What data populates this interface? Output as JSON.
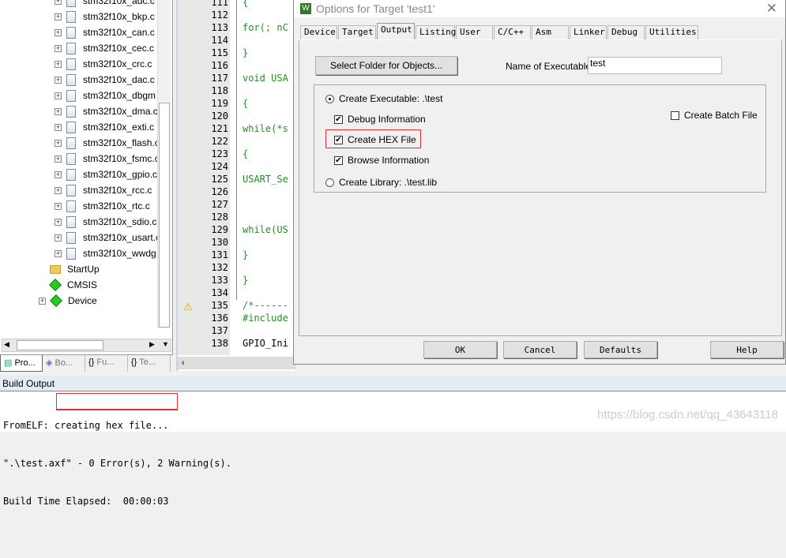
{
  "project": {
    "files": [
      "stm32f10x_adc.c",
      "stm32f10x_bkp.c",
      "stm32f10x_can.c",
      "stm32f10x_cec.c",
      "stm32f10x_crc.c",
      "stm32f10x_dac.c",
      "stm32f10x_dbgm",
      "stm32f10x_dma.c",
      "stm32f10x_exti.c",
      "stm32f10x_flash.c",
      "stm32f10x_fsmc.c",
      "stm32f10x_gpio.c",
      "stm32f10x_rcc.c",
      "stm32f10x_rtc.c",
      "stm32f10x_sdio.c",
      "stm32f10x_usart.c",
      "stm32f10x_wwdg."
    ],
    "groups": [
      {
        "label": "StartUp",
        "icon": "folder-icon"
      },
      {
        "label": "CMSIS",
        "icon": "component-icon"
      },
      {
        "label": "Device",
        "icon": "component-warning-icon"
      }
    ],
    "tabs": [
      "Pro...",
      "Bo...",
      "Fu...",
      "Te..."
    ]
  },
  "editor": {
    "lines": [
      [
        "111",
        "{"
      ],
      [
        "112",
        ""
      ],
      [
        "113",
        "for(; nC"
      ],
      [
        "114",
        ""
      ],
      [
        "115",
        "}"
      ],
      [
        "116",
        ""
      ],
      [
        "117",
        "void USA"
      ],
      [
        "118",
        ""
      ],
      [
        "119",
        "{"
      ],
      [
        "120",
        ""
      ],
      [
        "121",
        "while(*s"
      ],
      [
        "122",
        ""
      ],
      [
        "123",
        "{"
      ],
      [
        "124",
        ""
      ],
      [
        "125",
        "USART_Se"
      ],
      [
        "126",
        ""
      ],
      [
        "127",
        ""
      ],
      [
        "128",
        ""
      ],
      [
        "129",
        "while(US"
      ],
      [
        "130",
        ""
      ],
      [
        "131",
        "}"
      ],
      [
        "132",
        ""
      ],
      [
        "133",
        "}"
      ],
      [
        "134",
        ""
      ],
      [
        "135",
        "/*------"
      ],
      [
        "136",
        "#include"
      ],
      [
        "137",
        ""
      ],
      [
        "138",
        "GPIO_Ini"
      ]
    ],
    "warning_line": "135"
  },
  "dialog": {
    "title": "Options for Target 'test1'",
    "tabs": [
      "Device",
      "Target",
      "Output",
      "Listing",
      "User",
      "C/C++",
      "Asm",
      "Linker",
      "Debug",
      "Utilities"
    ],
    "active_tab": "Output",
    "select_folder": "Select Folder for Objects...",
    "name_label": "Name of Executable:",
    "name_value": "test",
    "create_exe": "Create Executable:  .\\test",
    "debug_info": "Debug Information",
    "create_hex": "Create HEX File",
    "browse_info": "Browse Information",
    "create_lib": "Create Library:  .\\test.lib",
    "batch": "Create Batch File",
    "ok": "OK",
    "cancel": "Cancel",
    "defaults": "Defaults",
    "help": "Help",
    "highlight_color": "#e03030"
  },
  "build": {
    "title": "Build Output",
    "lines": [
      "FromELF: creating hex file...",
      "\".\\test.axf\" - 0 Error(s), 2 Warning(s).",
      "Build Time Elapsed:  00:00:03"
    ],
    "watermark": "https://blog.csdn.net/qq_43643118"
  }
}
